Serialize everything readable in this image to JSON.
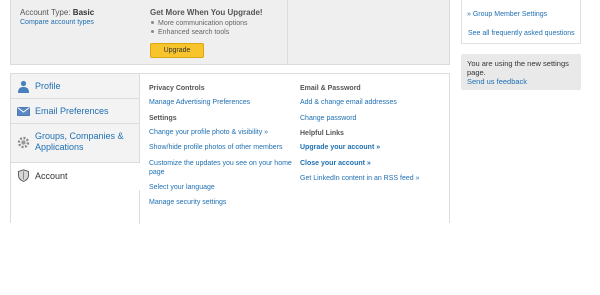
{
  "account": {
    "type_label": "Account Type:",
    "type_value": "Basic",
    "compare_link": "Compare account types"
  },
  "upgrade": {
    "title": "Get More When You Upgrade!",
    "benefits": [
      "More communication options",
      "Enhanced search tools"
    ],
    "button_label": "Upgrade"
  },
  "sidebar": {
    "group_member_link": "Group Member Settings",
    "faq_link": "See all frequently asked questions",
    "notice_text": "You are using the new settings page.",
    "feedback_link": "Send us feedback"
  },
  "nav": {
    "items": [
      {
        "label": "Profile",
        "icon": "person-icon"
      },
      {
        "label": "Email Preferences",
        "icon": "envelope-icon"
      },
      {
        "label": "Groups, Companies & Applications",
        "icon": "gear-icon"
      },
      {
        "label": "Account",
        "icon": "shield-icon",
        "active": true
      }
    ]
  },
  "content": {
    "privacy_header": "Privacy Controls",
    "manage_ads": "Manage Advertising Preferences",
    "settings_header": "Settings",
    "change_photo": "Change your profile photo & visibility »",
    "show_hide_photos": "Show/hide profile photos of other members",
    "customize_updates": "Customize the updates you see on your home page",
    "select_language": "Select your language",
    "manage_security": "Manage security settings",
    "email_header": "Email & Password",
    "add_email": "Add & change email addresses",
    "change_password": "Change password",
    "helpful_header": "Helpful Links",
    "upgrade_account": "Upgrade your account »",
    "close_account": "Close your account »",
    "rss_feed": "Get LinkedIn content in an RSS feed »"
  },
  "colors": {
    "link": "#1f6fb2",
    "upgrade_button": "#f7c52b",
    "panel_bg": "#efefef"
  }
}
